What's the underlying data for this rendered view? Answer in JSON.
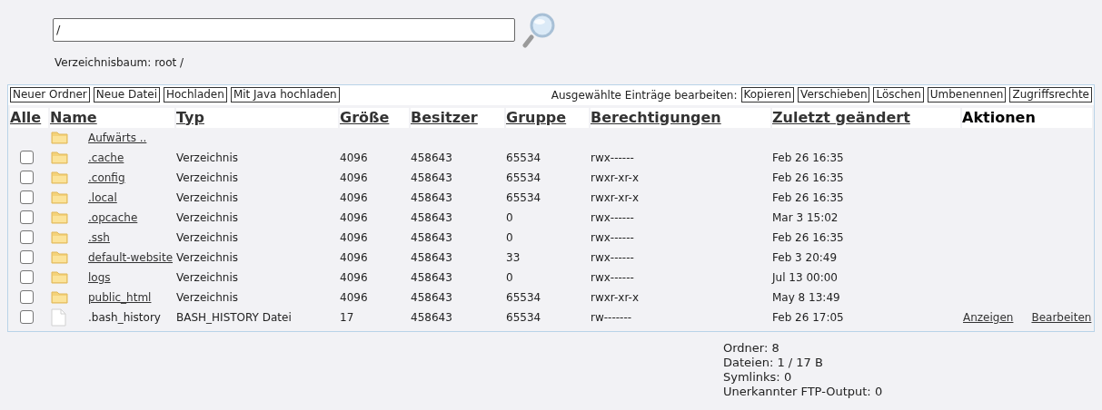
{
  "path_field": {
    "value": "/"
  },
  "breadcrumb": "Verzeichnisbaum: root /",
  "toolbar_left": [
    "Neuer Ordner",
    "Neue Datei",
    "Hochladen",
    "Mit Java hochladen"
  ],
  "toolbar_right_label": "Ausgewählte Einträge bearbeiten:",
  "toolbar_right": [
    "Kopieren",
    "Verschieben",
    "Löschen",
    "Umbenennen",
    "Zugriffsrechte"
  ],
  "columns": [
    {
      "label": "Alle",
      "sortable": true
    },
    {
      "label": "Name",
      "sortable": true
    },
    {
      "label": "Typ",
      "sortable": true
    },
    {
      "label": "Größe",
      "sortable": true
    },
    {
      "label": "Besitzer",
      "sortable": true
    },
    {
      "label": "Gruppe",
      "sortable": true
    },
    {
      "label": "Berechtigungen",
      "sortable": true
    },
    {
      "label": "Zuletzt geändert",
      "sortable": true
    },
    {
      "label": "Aktionen",
      "sortable": false
    }
  ],
  "rows": [
    {
      "kind": "up",
      "name": "Aufwärts .."
    },
    {
      "kind": "folder",
      "checked": false,
      "name": ".cache",
      "type": "Verzeichnis",
      "size": "4096",
      "owner": "458643",
      "group": "65534",
      "permissions": "rwx------",
      "modified": "Feb 26 16:35"
    },
    {
      "kind": "folder",
      "checked": false,
      "name": ".config",
      "type": "Verzeichnis",
      "size": "4096",
      "owner": "458643",
      "group": "65534",
      "permissions": "rwxr-xr-x",
      "modified": "Feb 26 16:35"
    },
    {
      "kind": "folder",
      "checked": false,
      "name": ".local",
      "type": "Verzeichnis",
      "size": "4096",
      "owner": "458643",
      "group": "65534",
      "permissions": "rwxr-xr-x",
      "modified": "Feb 26 16:35"
    },
    {
      "kind": "folder",
      "checked": false,
      "name": ".opcache",
      "type": "Verzeichnis",
      "size": "4096",
      "owner": "458643",
      "group": "0",
      "permissions": "rwx------",
      "modified": "Mar 3 15:02"
    },
    {
      "kind": "folder",
      "checked": false,
      "name": ".ssh",
      "type": "Verzeichnis",
      "size": "4096",
      "owner": "458643",
      "group": "0",
      "permissions": "rwx------",
      "modified": "Feb 26 16:35"
    },
    {
      "kind": "folder",
      "checked": false,
      "name": "default-website",
      "type": "Verzeichnis",
      "size": "4096",
      "owner": "458643",
      "group": "33",
      "permissions": "rwx------",
      "modified": "Feb 3 20:49"
    },
    {
      "kind": "folder",
      "checked": false,
      "name": "logs",
      "type": "Verzeichnis",
      "size": "4096",
      "owner": "458643",
      "group": "0",
      "permissions": "rwx------",
      "modified": "Jul 13 00:00"
    },
    {
      "kind": "folder",
      "checked": false,
      "name": "public_html",
      "type": "Verzeichnis",
      "size": "4096",
      "owner": "458643",
      "group": "65534",
      "permissions": "rwxr-xr-x",
      "modified": "May 8 13:49"
    },
    {
      "kind": "file",
      "checked": false,
      "name": ".bash_history",
      "type": "BASH_HISTORY Datei",
      "size": "17",
      "owner": "458643",
      "group": "65534",
      "permissions": "rw-------",
      "modified": "Feb 26 17:05",
      "actions": [
        "Anzeigen",
        "Bearbeiten"
      ]
    }
  ],
  "summary": [
    "Ordner: 8",
    "Dateien: 1 / 17 B",
    "Symlinks: 0",
    "Unerkannter FTP-Output: 0"
  ]
}
